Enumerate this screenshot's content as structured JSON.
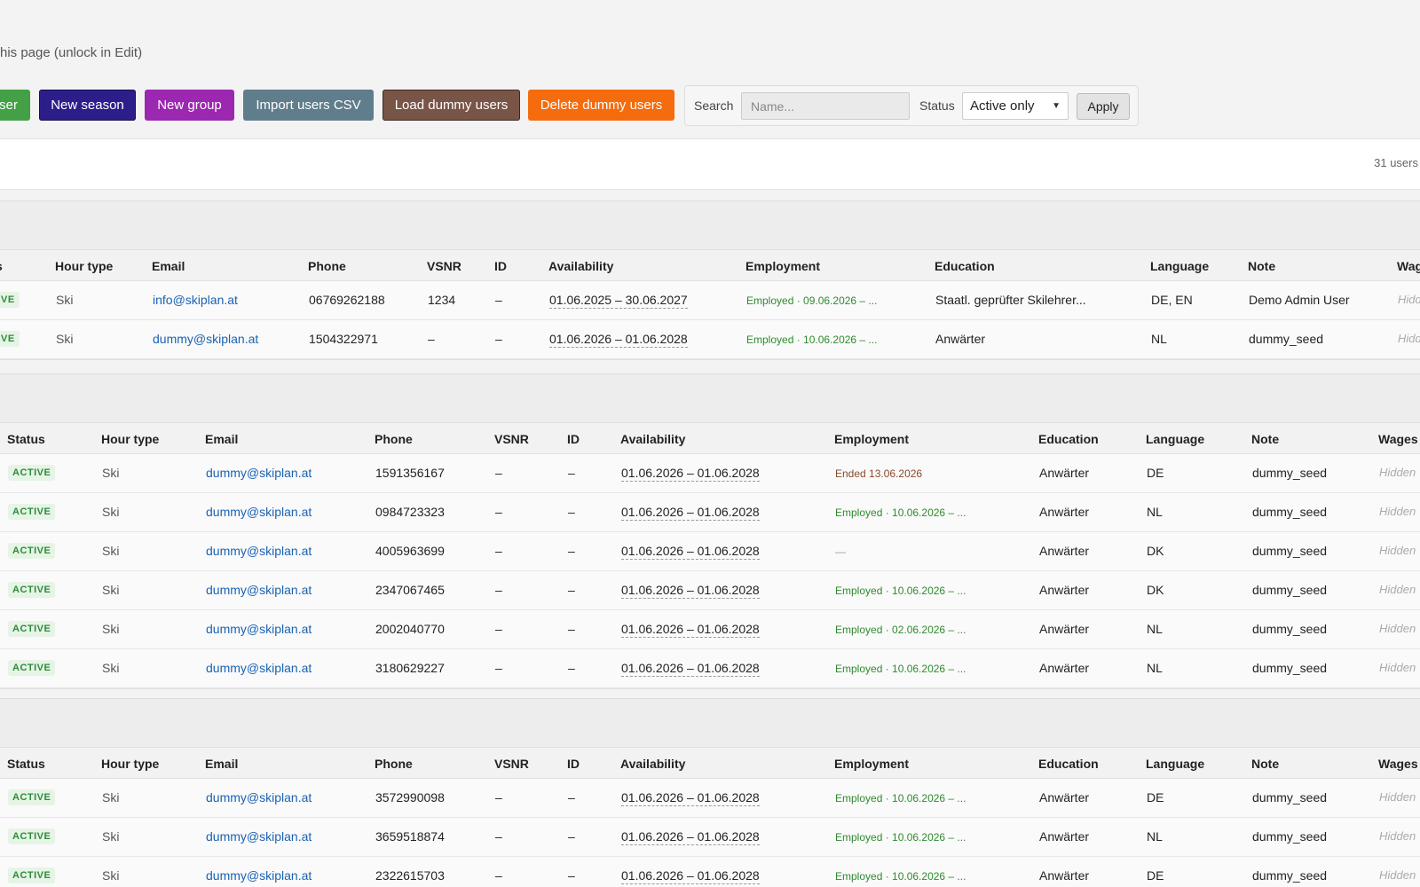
{
  "page": {
    "lock_hint": "his page (unlock in Edit)"
  },
  "toolbar": {
    "new_user": "ser",
    "new_season": "New season",
    "new_group": "New group",
    "import_csv": "Import users CSV",
    "load_dummy": "Load dummy users",
    "delete_dummy": "Delete dummy users"
  },
  "filter": {
    "search_label": "Search",
    "search_placeholder": "Name...",
    "status_label": "Status",
    "status_value": "Active only",
    "apply": "Apply"
  },
  "summary": {
    "user_count": "31 users"
  },
  "colors": {
    "active_badge": "#2e8b3a",
    "employed": "#2e8b2e",
    "link": "#1a62b3",
    "delete_button": "#f46c0d"
  },
  "groups": [
    {
      "headers": {
        "status": "s",
        "hour_type": "Hour type",
        "email": "Email",
        "phone": "Phone",
        "vsnr": "VSNR",
        "id": "ID",
        "availability": "Availability",
        "employment": "Employment",
        "education": "Education",
        "language": "Language",
        "note": "Note",
        "wages": "Wag"
      },
      "rows": [
        {
          "status": "VE",
          "hour_type": "Ski",
          "email": "info@skiplan.at",
          "phone": "06769262188",
          "vsnr": "1234",
          "id": "–",
          "availability": "01.06.2025 – 30.06.2027",
          "employment": "Employed · 09.06.2026 – ...",
          "education": "Staatl. geprüfter Skilehrer...",
          "language": "DE, EN",
          "note": "Demo Admin User",
          "wages": "Hidd"
        },
        {
          "status": "VE",
          "hour_type": "Ski",
          "email": "dummy@skiplan.at",
          "phone": "1504322971",
          "vsnr": "–",
          "id": "–",
          "availability": "01.06.2026 – 01.06.2028",
          "employment": "Employed · 10.06.2026 – ...",
          "education": "Anwärter",
          "language": "NL",
          "note": "dummy_seed",
          "wages": "Hidd"
        }
      ]
    },
    {
      "headers": {
        "status": "Status",
        "hour_type": "Hour type",
        "email": "Email",
        "phone": "Phone",
        "vsnr": "VSNR",
        "id": "ID",
        "availability": "Availability",
        "employment": "Employment",
        "education": "Education",
        "language": "Language",
        "note": "Note",
        "wages": "Wages"
      },
      "rows": [
        {
          "status": "ACTIVE",
          "hour_type": "Ski",
          "email": "dummy@skiplan.at",
          "phone": "1591356167",
          "vsnr": "–",
          "id": "–",
          "availability": "01.06.2026 – 01.06.2028",
          "employment": "Ended 13.06.2026",
          "employment_state": "ended",
          "education": "Anwärter",
          "language": "DE",
          "note": "dummy_seed",
          "wages": "Hidden"
        },
        {
          "status": "ACTIVE",
          "hour_type": "Ski",
          "email": "dummy@skiplan.at",
          "phone": "0984723323",
          "vsnr": "–",
          "id": "–",
          "availability": "01.06.2026 – 01.06.2028",
          "employment": "Employed · 10.06.2026 – ...",
          "education": "Anwärter",
          "language": "NL",
          "note": "dummy_seed",
          "wages": "Hidden"
        },
        {
          "status": "ACTIVE",
          "hour_type": "Ski",
          "email": "dummy@skiplan.at",
          "phone": "4005963699",
          "vsnr": "–",
          "id": "–",
          "availability": "01.06.2026 – 01.06.2028",
          "employment": "—",
          "employment_state": "none",
          "education": "Anwärter",
          "language": "DK",
          "note": "dummy_seed",
          "wages": "Hidden"
        },
        {
          "status": "ACTIVE",
          "hour_type": "Ski",
          "email": "dummy@skiplan.at",
          "phone": "2347067465",
          "vsnr": "–",
          "id": "–",
          "availability": "01.06.2026 – 01.06.2028",
          "employment": "Employed · 10.06.2026 – ...",
          "education": "Anwärter",
          "language": "DK",
          "note": "dummy_seed",
          "wages": "Hidden"
        },
        {
          "status": "ACTIVE",
          "hour_type": "Ski",
          "email": "dummy@skiplan.at",
          "phone": "2002040770",
          "vsnr": "–",
          "id": "–",
          "availability": "01.06.2026 – 01.06.2028",
          "employment": "Employed · 02.06.2026 – ...",
          "education": "Anwärter",
          "language": "NL",
          "note": "dummy_seed",
          "wages": "Hidden"
        },
        {
          "status": "ACTIVE",
          "hour_type": "Ski",
          "email": "dummy@skiplan.at",
          "phone": "3180629227",
          "vsnr": "–",
          "id": "–",
          "availability": "01.06.2026 – 01.06.2028",
          "employment": "Employed · 10.06.2026 – ...",
          "education": "Anwärter",
          "language": "NL",
          "note": "dummy_seed",
          "wages": "Hidden"
        }
      ]
    },
    {
      "headers": {
        "status": "Status",
        "hour_type": "Hour type",
        "email": "Email",
        "phone": "Phone",
        "vsnr": "VSNR",
        "id": "ID",
        "availability": "Availability",
        "employment": "Employment",
        "education": "Education",
        "language": "Language",
        "note": "Note",
        "wages": "Wages"
      },
      "rows": [
        {
          "status": "ACTIVE",
          "hour_type": "Ski",
          "email": "dummy@skiplan.at",
          "phone": "3572990098",
          "vsnr": "–",
          "id": "–",
          "availability": "01.06.2026 – 01.06.2028",
          "employment": "Employed · 10.06.2026 – ...",
          "education": "Anwärter",
          "language": "DE",
          "note": "dummy_seed",
          "wages": "Hidden"
        },
        {
          "status": "ACTIVE",
          "hour_type": "Ski",
          "email": "dummy@skiplan.at",
          "phone": "3659518874",
          "vsnr": "–",
          "id": "–",
          "availability": "01.06.2026 – 01.06.2028",
          "employment": "Employed · 10.06.2026 – ...",
          "education": "Anwärter",
          "language": "NL",
          "note": "dummy_seed",
          "wages": "Hidden"
        },
        {
          "status": "ACTIVE",
          "hour_type": "Ski",
          "email": "dummy@skiplan.at",
          "phone": "2322615703",
          "vsnr": "–",
          "id": "–",
          "availability": "01.06.2026 – 01.06.2028",
          "employment": "Employed · 10.06.2026 – ...",
          "education": "Anwärter",
          "language": "DE",
          "note": "dummy_seed",
          "wages": "Hidden"
        }
      ]
    }
  ]
}
